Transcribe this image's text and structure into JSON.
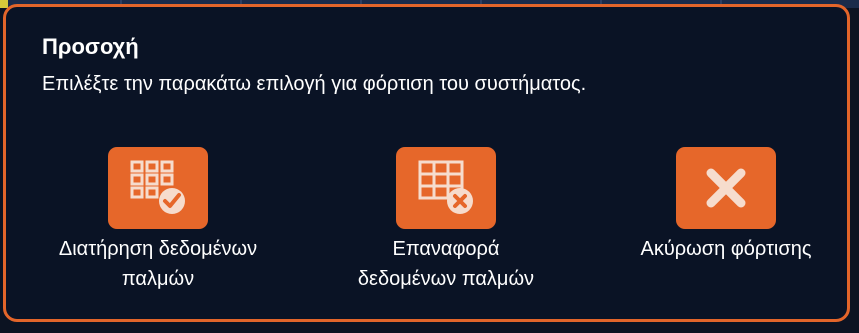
{
  "dialog": {
    "title": "Προσοχή",
    "message": "Επιλέξτε την παρακάτω επιλογή για φόρτιση του συστήματος.",
    "options": [
      {
        "label_line1": "Διατήρηση δεδομένων",
        "label_line2": "παλμών",
        "icon": "grid-check-icon"
      },
      {
        "label_line1": "Επαναφορά",
        "label_line2": "δεδομένων παλμών",
        "icon": "grid-x-icon"
      },
      {
        "label_line1": "Ακύρωση φόρτισης",
        "label_line2": "",
        "icon": "close-icon"
      }
    ]
  },
  "colors": {
    "accent": "#e6672a",
    "border": "#e3652a",
    "background": "#0a1325",
    "text": "#ffffff"
  }
}
